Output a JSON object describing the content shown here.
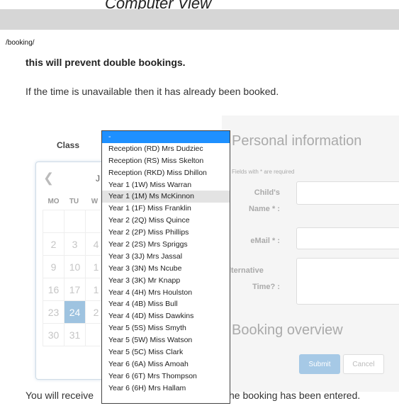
{
  "page": {
    "view_title": "Computer View",
    "url": "/booking/",
    "intro_bold": "this will prevent double bookings.",
    "intro_text": "If the time is unavailable then it has already been booked.",
    "bottom_left": "You will receive",
    "bottom_right": "he booking has been entered."
  },
  "class_select": {
    "label": "Class",
    "selected_index": 0,
    "hover_index": 5,
    "options": [
      "-",
      "Reception (RD) Mrs Dudziec",
      "Reception (RS) Miss Skelton",
      "Reception (RKD) Miss Dhillon",
      "Year 1 (1W) Miss Warran",
      "Year 1 (1M) Ms McKinnon",
      "Year 1 (1F) Miss Franklin",
      "Year 2 (2Q) Miss Quince",
      "Year 2 (2P) Miss Phillips",
      "Year 2 (2S) Mrs Spriggs",
      "Year 3 (3J) Mrs Jassal",
      "Year 3 (3N) Ms Ncube",
      "Year 3 (3K) Mr Knapp",
      "Year 4 (4H) Mrs Houlston",
      "Year 4 (4B) Miss Bull",
      "Year 4 (4D) Miss Dawkins",
      "Year 5 (5S) Miss Smyth",
      "Year 5 (5W) Miss Watson",
      "Year 5 (5C) Miss Clark",
      "Year 6 (6A) Miss Amoah",
      "Year 6 (6T) Mrs Thompson",
      "Year 6 (6H) Mrs Hallam"
    ]
  },
  "calendar": {
    "prev_icon": "chevron-left-icon",
    "month_partial": "J",
    "weekdays": [
      "MO",
      "TU",
      "W"
    ],
    "rows": [
      [
        "",
        "",
        ""
      ],
      [
        "2",
        "3",
        "4"
      ],
      [
        "9",
        "10",
        "1"
      ],
      [
        "16",
        "17",
        "1"
      ],
      [
        "23",
        "24",
        "2"
      ],
      [
        "30",
        "31",
        ""
      ]
    ],
    "selected_day": "24"
  },
  "form": {
    "title": "Personal information",
    "required_note": "Fields with * are required",
    "child_name_label_1": "Child's",
    "child_name_label_2": "Name * :",
    "email_label": "eMail * :",
    "alt_time_label_1": "Alternative",
    "alt_time_label_2": "Time? :",
    "booking_overview": "Booking overview",
    "submit_label": "Submit",
    "cancel_label": "Cancel"
  },
  "colors": {
    "dropdown_selected": "#1e90ff",
    "dropdown_hover": "#e3e3e3",
    "calendar_selected": "#9ec3e0",
    "submit_button": "#a6c9e6"
  }
}
